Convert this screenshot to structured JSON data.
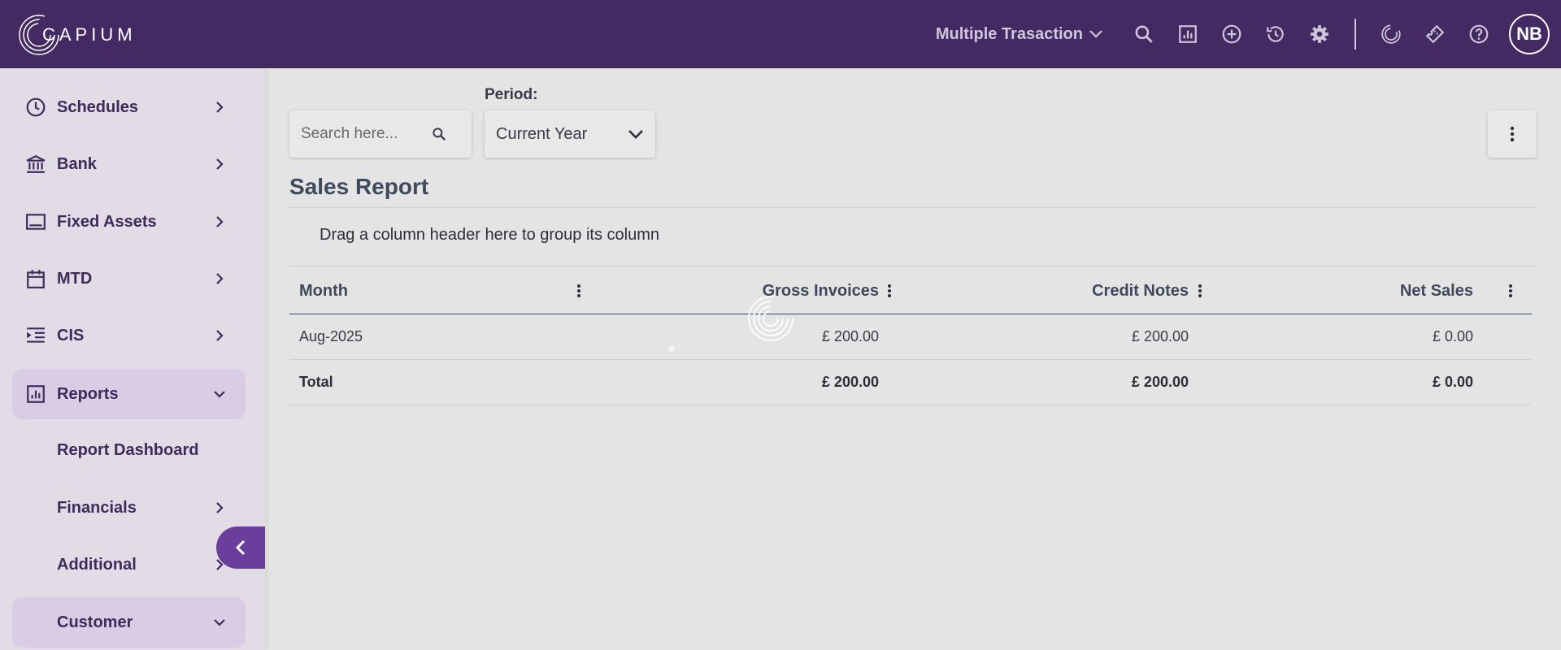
{
  "app": {
    "logo_text": "CAPIUM"
  },
  "header": {
    "transaction_selector": "Multiple Trasaction",
    "icons": [
      "search-icon",
      "report-icon",
      "add-circle-icon",
      "history-icon",
      "gear-icon",
      "capium-icon",
      "ticket-icon",
      "help-icon"
    ],
    "avatar_initials": "NB"
  },
  "sidebar": {
    "items": [
      {
        "label": "Schedules",
        "icon": "clock-icon"
      },
      {
        "label": "Bank",
        "icon": "bank-icon"
      },
      {
        "label": "Fixed Assets",
        "icon": "monitor-icon"
      },
      {
        "label": "MTD",
        "icon": "calendar-icon"
      },
      {
        "label": "CIS",
        "icon": "indent-icon"
      },
      {
        "label": "Reports",
        "icon": "report-icon",
        "expanded": true
      },
      {
        "label": "Report Dashboard"
      },
      {
        "label": "Financials"
      },
      {
        "label": "Additional"
      },
      {
        "label": "Customer",
        "expanded": true
      }
    ]
  },
  "toolbar": {
    "search_placeholder": "Search here...",
    "period_label": "Period:",
    "period_value": "Current Year"
  },
  "report": {
    "title": "Sales Report",
    "group_panel_text": "Drag a column header here to group its column",
    "columns": [
      "Month",
      "Gross Invoices",
      "Credit Notes",
      "Net Sales"
    ],
    "rows": [
      {
        "month": "Aug-2025",
        "gross": "£ 200.00",
        "credit": "£ 200.00",
        "net": "£ 0.00"
      }
    ],
    "total": {
      "label": "Total",
      "gross": "£ 200.00",
      "credit": "£ 200.00",
      "net": "£ 0.00"
    }
  },
  "colors": {
    "header_bg": "#432a62",
    "accent": "#6a3e9a",
    "sidebar_bg": "#e2dce6",
    "active_item_bg": "#d9cde6"
  }
}
